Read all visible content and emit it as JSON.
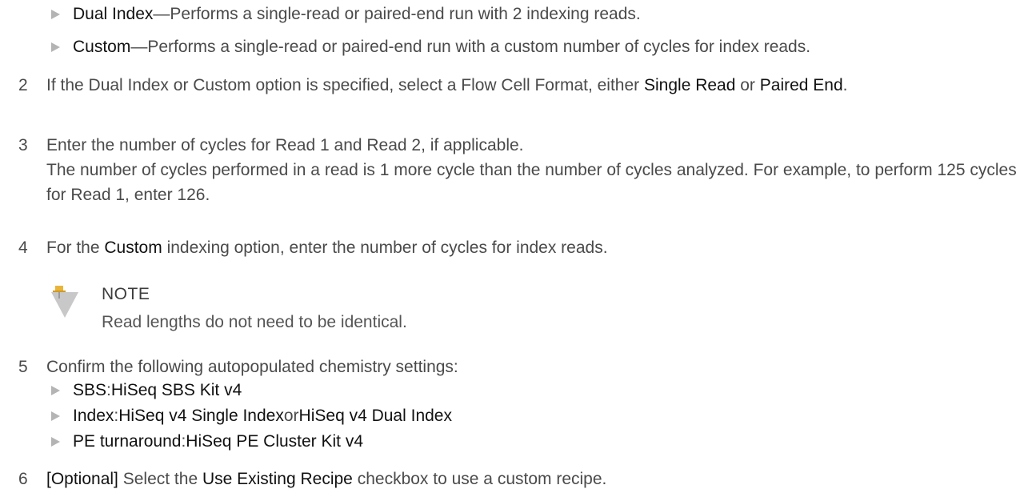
{
  "bullets_top": [
    {
      "bold": "Dual Index",
      "rest": "—Performs a single-read or paired-end run with 2 indexing reads."
    },
    {
      "bold": "Custom",
      "rest": "—Performs a single-read or paired-end run with a custom number of cycles for index reads."
    }
  ],
  "step2": {
    "num": "2",
    "text1": "If the Dual Index or Custom option is specified, select a Flow Cell Format, either ",
    "bold1": "Single Read",
    "text2": " or ",
    "bold2": "Paired End",
    "text3": "."
  },
  "step3": {
    "num": "3",
    "line1": "Enter the number of cycles for Read 1 and Read 2, if applicable.",
    "line2": "The number of cycles performed in a read is 1 more cycle than the number of cycles analyzed. For example, to perform 125 cycles for Read 1, enter 126."
  },
  "step4": {
    "num": "4",
    "text1": "For the ",
    "bold1": "Custom",
    "text2": " indexing option, enter the number of cycles for index reads."
  },
  "note": {
    "title": "NOTE",
    "body": "Read lengths do not need to be identical."
  },
  "step5": {
    "num": "5",
    "text": "Confirm the following autopopulated chemistry settings:",
    "bullets": [
      {
        "b1": "SBS",
        "t1": ": ",
        "b2": "HiSeq SBS Kit v4",
        "t2": "",
        "b3": ""
      },
      {
        "b1": "Index",
        "t1": ": ",
        "b2": "HiSeq v4 Single Index",
        "t2": " or ",
        "b3": "HiSeq v4 Dual Index"
      },
      {
        "b1": "PE turnaround",
        "t1": ": ",
        "b2": "HiSeq PE Cluster Kit v4",
        "t2": "",
        "b3": ""
      }
    ]
  },
  "step6": {
    "num": "6",
    "bold1": "[Optional]",
    "text1": " Select the ",
    "bold2": "Use Existing Recipe",
    "text2": " checkbox to use a custom recipe."
  },
  "colors": {
    "text": "#4a4a4a",
    "emphasis": "#111111",
    "bullet": "#b4b4b4",
    "note_icon_pin": "#e8b53a"
  },
  "icons": {
    "note": "pushpin-note-icon",
    "bullet": "triangle-bullet-icon"
  }
}
